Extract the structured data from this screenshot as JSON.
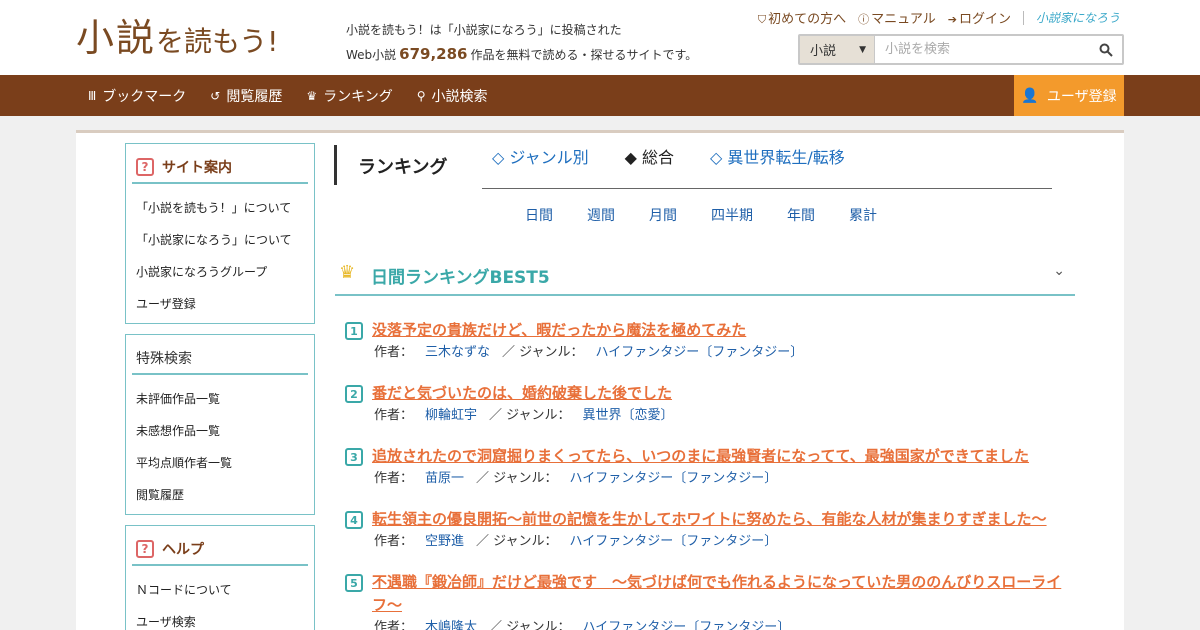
{
  "header": {
    "logo_main": "小説",
    "logo_sub": "を読もう!",
    "tagline_line1": "小説を読もう！は「小説家になろう」に投稿された",
    "tagline_prefix": "Web小説",
    "work_count": "679,286",
    "tagline_suffix": "作品を無料で読める・探せるサイトです。",
    "topnav": {
      "beginner": "初めての方へ",
      "manual": "マニュアル",
      "login": "ログイン",
      "narou": "小説家になろう"
    },
    "search": {
      "type_selected": "小説",
      "placeholder": "小説を検索"
    }
  },
  "navbar": {
    "items": [
      "ブックマーク",
      "閲覧履歴",
      "ランキング",
      "小説検索"
    ],
    "register": "ユーザ登録"
  },
  "sidebar": {
    "site_guide": {
      "title": "サイト案内",
      "items": [
        "「小説を読もう！」について",
        "「小説家になろう」について",
        "小説家になろうグループ",
        "ユーザ登録"
      ]
    },
    "special_search": {
      "title": "特殊検索",
      "items": [
        "未評価作品一覧",
        "未感想作品一覧",
        "平均点順作者一覧",
        "閲覧履歴"
      ]
    },
    "help": {
      "title": "ヘルプ",
      "items": [
        "Ｎコードについて",
        "ユーザ検索"
      ]
    }
  },
  "ranking": {
    "title": "ランキング",
    "tabs": [
      "◇ ジャンル別",
      "◆ 総合",
      "◇ 異世界転生/転移"
    ],
    "periods": [
      "日間",
      "週間",
      "月間",
      "四半期",
      "年間",
      "累計"
    ],
    "best_title": "日間ランキングBEST5",
    "author_label": "作者：",
    "genre_label": "／ ジャンル：",
    "entries": [
      {
        "rank": "1",
        "title": "没落予定の貴族だけど、暇だったから魔法を極めてみた",
        "author": "三木なずな",
        "genre": "ハイファンタジー〔ファンタジー〕"
      },
      {
        "rank": "2",
        "title": "番だと気づいたのは、婚約破棄した後でした",
        "author": "柳輪虹宇",
        "genre": "異世界〔恋愛〕"
      },
      {
        "rank": "3",
        "title": "追放されたので洞窟掘りまくってたら、いつのまに最強賢者になってて、最強国家ができてました",
        "author": "苗原一",
        "genre": "ハイファンタジー〔ファンタジー〕"
      },
      {
        "rank": "4",
        "title": "転生領主の優良開拓〜前世の記憶を生かしてホワイトに努めたら、有能な人材が集まりすぎました〜",
        "author": "空野進",
        "genre": "ハイファンタジー〔ファンタジー〕"
      },
      {
        "rank": "5",
        "title": "不遇職『鍛冶師』だけど最強です　～気づけば何でも作れるようになっていた男ののんびりスローライフ～",
        "author": "木嶋隆太",
        "genre": "ハイファンタジー〔ファンタジー〕"
      }
    ]
  }
}
